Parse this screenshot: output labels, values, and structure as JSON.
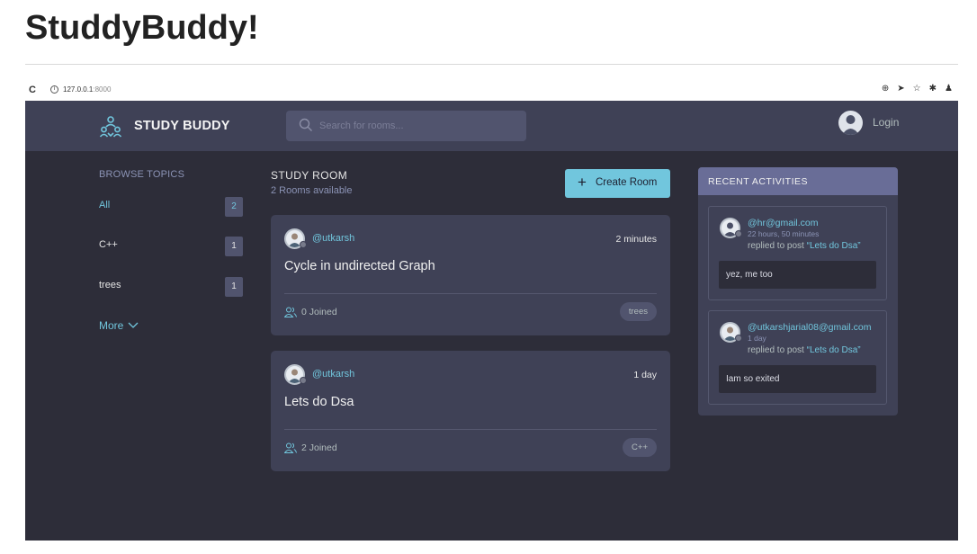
{
  "page": {
    "title": "StuddyBuddy!"
  },
  "browser": {
    "url_host": "127.0.0.1",
    "url_port": ":8000",
    "reload_icon": "reload-icon",
    "info_icon": "info-icon",
    "toolbar_icons": [
      "zoom-icon",
      "send-icon",
      "star-icon",
      "extensions-icon",
      "profile-icon"
    ]
  },
  "header": {
    "brand": "STUDY BUDDY",
    "search_placeholder": "Search for rooms...",
    "login": "Login"
  },
  "topics": {
    "title": "BROWSE TOPICS",
    "items": [
      {
        "label": "All",
        "count": "2",
        "active": true
      },
      {
        "label": "C++",
        "count": "1",
        "active": false
      },
      {
        "label": "trees",
        "count": "1",
        "active": false
      }
    ],
    "more": "More"
  },
  "rooms": {
    "heading": "STUDY ROOM",
    "count_text": "2 Rooms available",
    "create_label": "Create Room",
    "items": [
      {
        "host": "@utkarsh",
        "time": "2 minutes",
        "title": "Cycle in undirected Graph",
        "joined": "0 Joined",
        "topic": "trees"
      },
      {
        "host": "@utkarsh",
        "time": "1 day",
        "title": "Lets do Dsa",
        "joined": "2 Joined",
        "topic": "C++"
      }
    ]
  },
  "activities": {
    "title": "RECENT ACTIVITIES",
    "items": [
      {
        "user": "@hr@gmail.com",
        "time": "22 hours, 50 minutes",
        "action": "replied to post",
        "room": "“Lets do Dsa”",
        "message": "yez, me too"
      },
      {
        "user": "@utkarshjarial08@gmail.com",
        "time": "1 day",
        "action": "replied to post",
        "room": "“Lets do Dsa”",
        "message": "Iam so exited"
      }
    ]
  },
  "colors": {
    "accent": "#71c6dd",
    "background": "#2d2d39",
    "panel": "#3f4156",
    "activities_header": "#696d97"
  }
}
